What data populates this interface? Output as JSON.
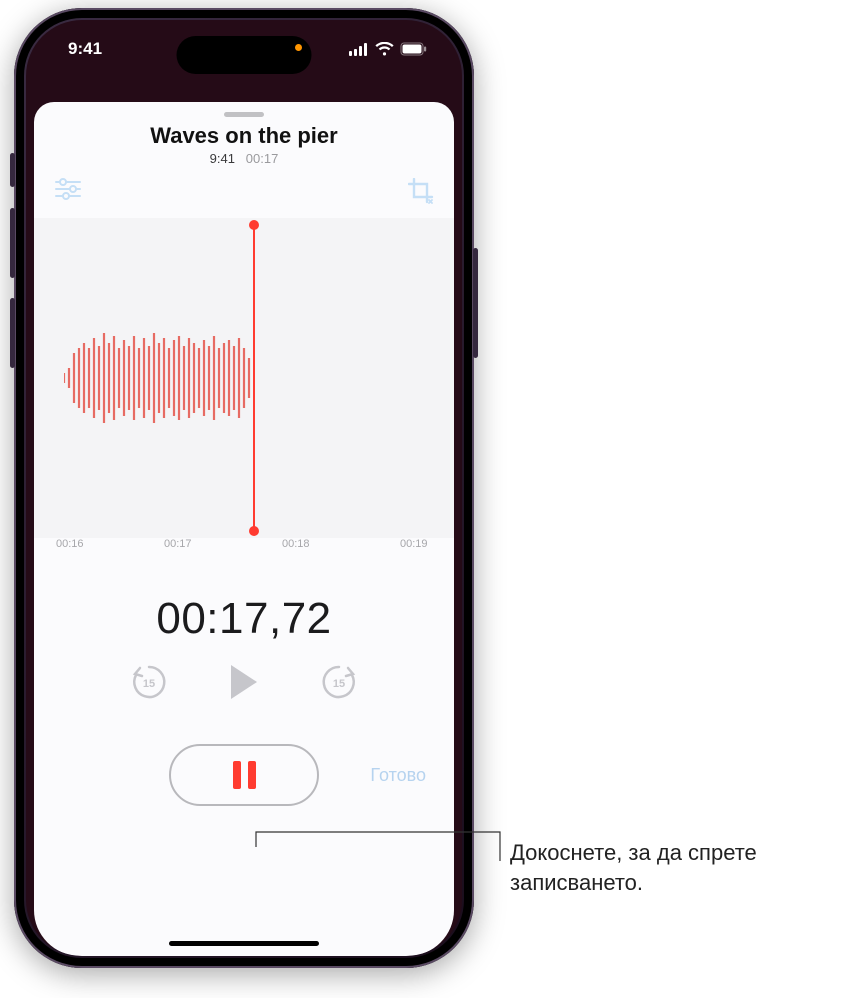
{
  "status": {
    "time": "9:41",
    "privacy_indicator": "orange-dot"
  },
  "recording": {
    "title": "Waves on the pier",
    "time_of_day": "9:41",
    "duration_short": "00:17",
    "elapsed": "00:17,72"
  },
  "ruler": {
    "t0": "00:16",
    "t1": "00:17",
    "t2": "00:18",
    "t3": "00:19"
  },
  "controls": {
    "skip_back_badge": "15",
    "skip_fwd_badge": "15",
    "done_label": "Готово"
  },
  "callout": {
    "text": "Докоснете, за да спрете записването."
  }
}
